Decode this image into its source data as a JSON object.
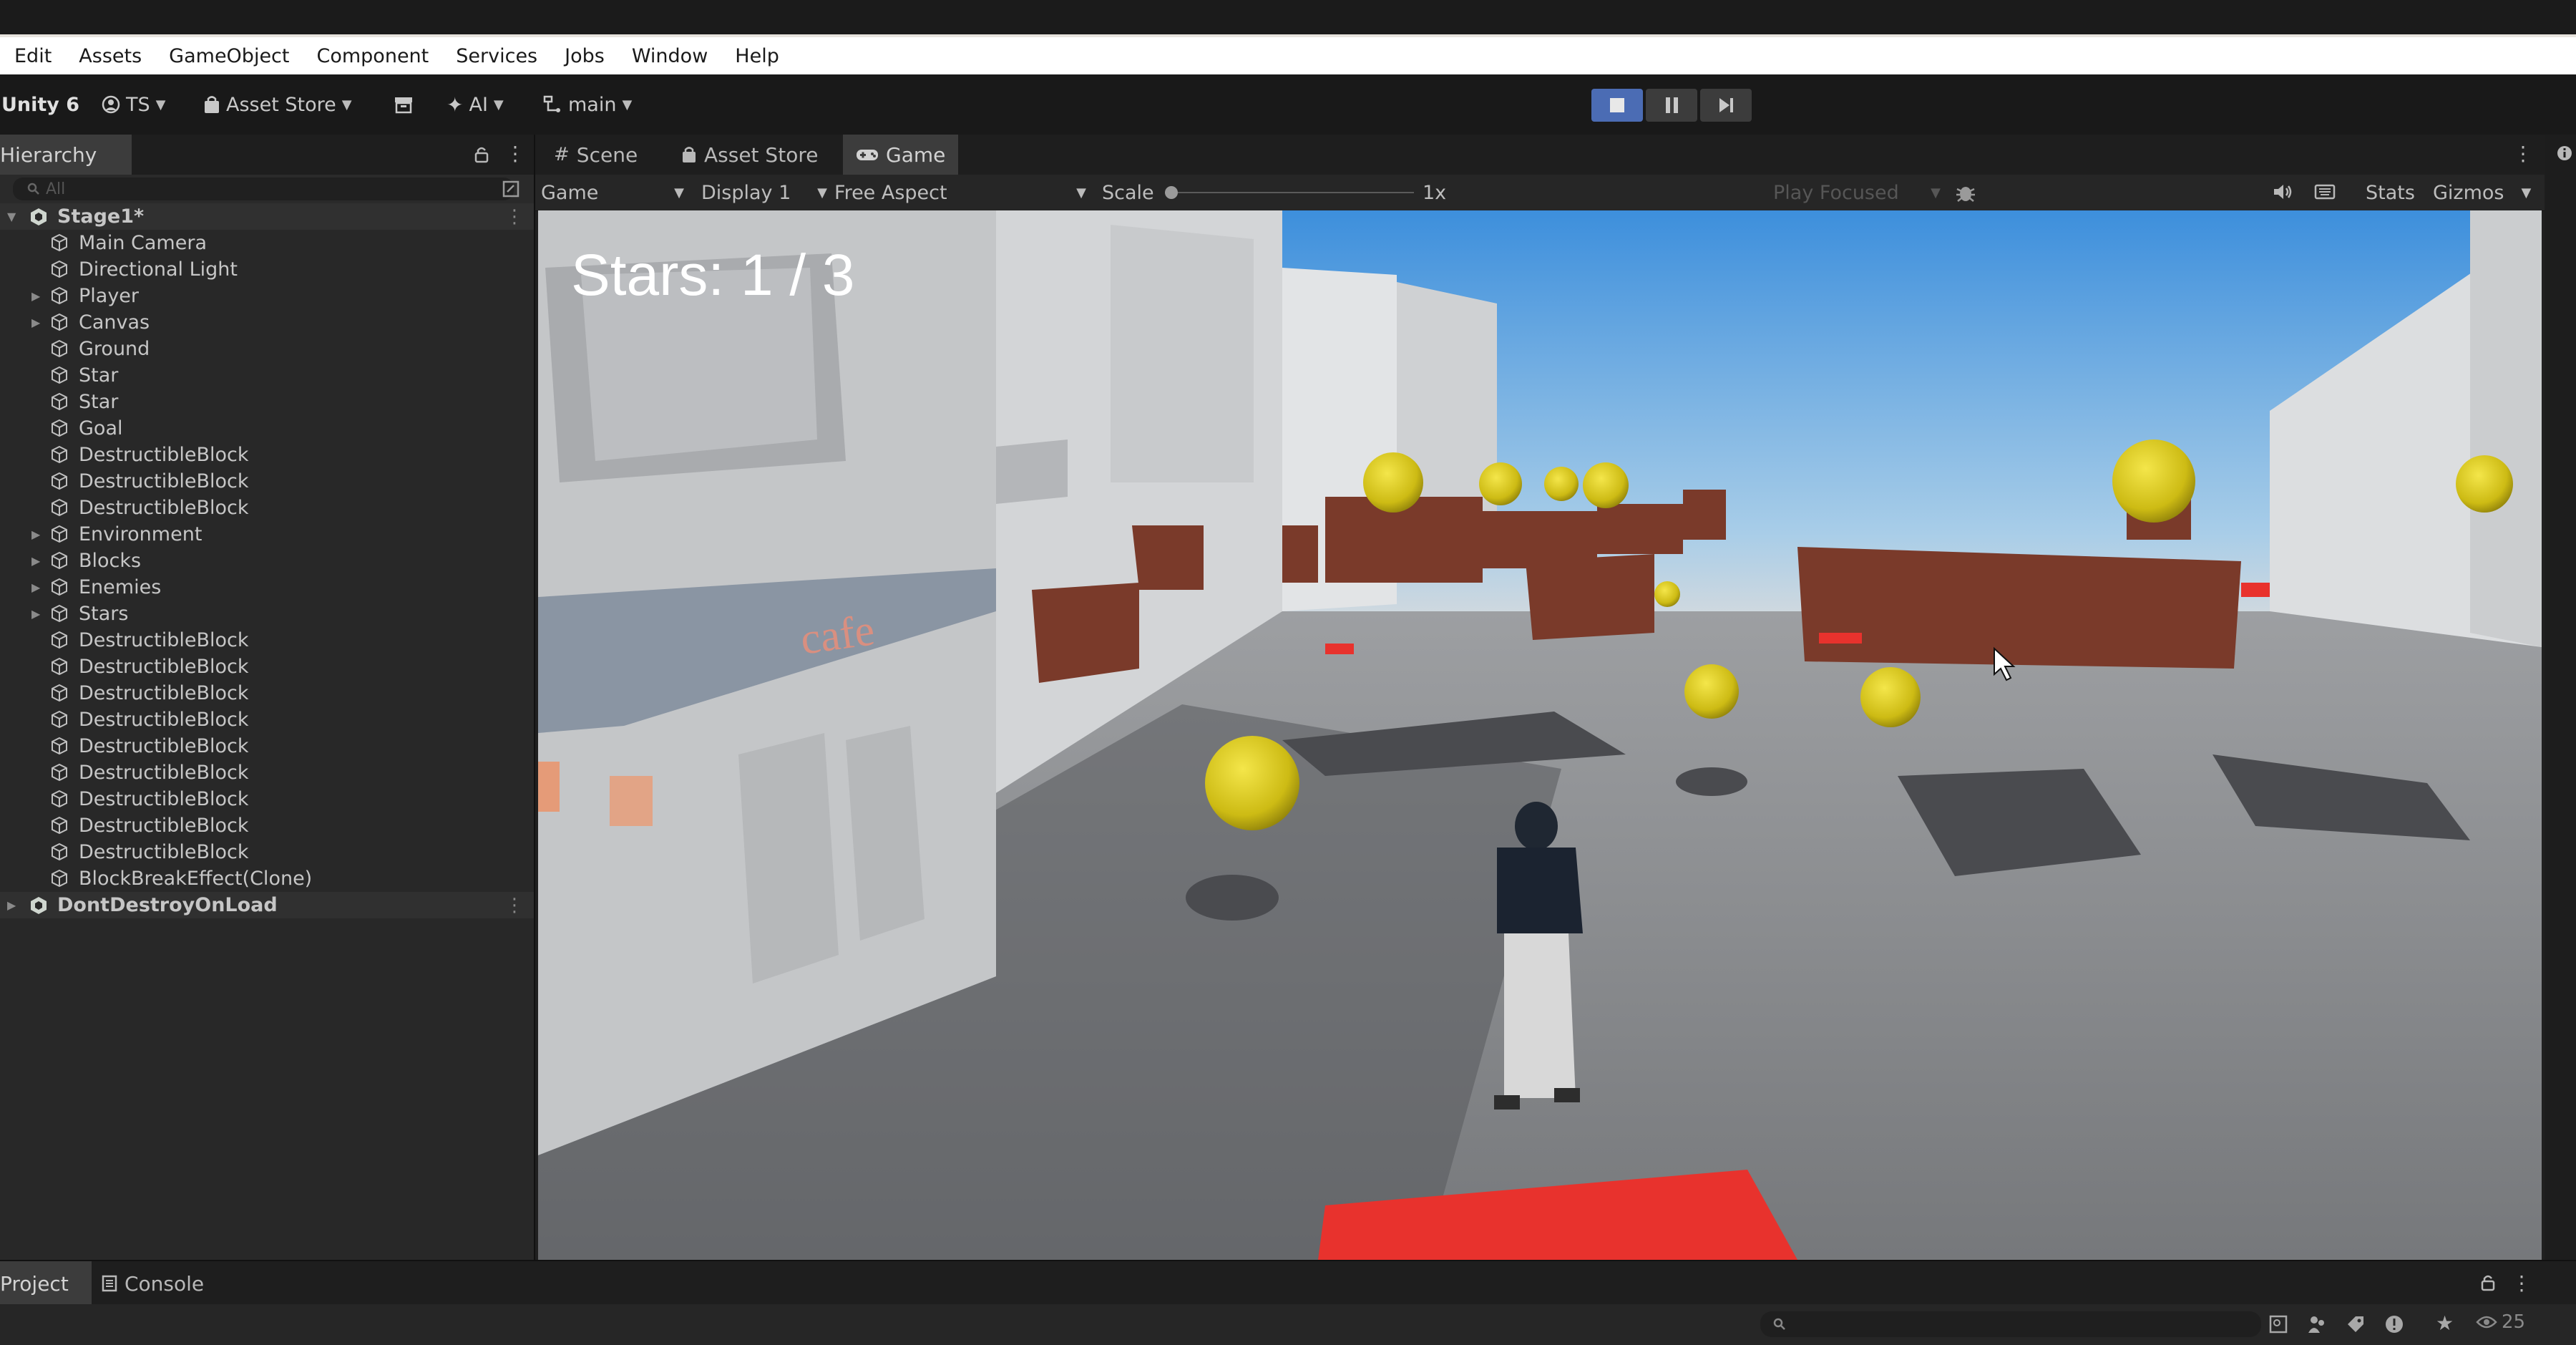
{
  "menu": [
    "Edit",
    "Assets",
    "GameObject",
    "Component",
    "Services",
    "Jobs",
    "Window",
    "Help"
  ],
  "toolbar": {
    "brand": "Unity 6",
    "account": "TS",
    "asset_store": "Asset Store",
    "ai": "AI",
    "branch": "main"
  },
  "hierarchy": {
    "tab_label": "Hierarchy",
    "search_placeholder": "All",
    "scene": "Stage1*",
    "items": [
      {
        "label": "Main Camera",
        "expandable": false
      },
      {
        "label": "Directional Light",
        "expandable": false
      },
      {
        "label": "Player",
        "expandable": true
      },
      {
        "label": "Canvas",
        "expandable": true
      },
      {
        "label": "Ground",
        "expandable": false
      },
      {
        "label": "Star",
        "expandable": false
      },
      {
        "label": "Star",
        "expandable": false
      },
      {
        "label": "Goal",
        "expandable": false
      },
      {
        "label": "DestructibleBlock",
        "expandable": false
      },
      {
        "label": "DestructibleBlock",
        "expandable": false
      },
      {
        "label": "DestructibleBlock",
        "expandable": false
      },
      {
        "label": "Environment",
        "expandable": true
      },
      {
        "label": "Blocks",
        "expandable": true
      },
      {
        "label": "Enemies",
        "expandable": true
      },
      {
        "label": "Stars",
        "expandable": true
      },
      {
        "label": "DestructibleBlock",
        "expandable": false
      },
      {
        "label": "DestructibleBlock",
        "expandable": false
      },
      {
        "label": "DestructibleBlock",
        "expandable": false
      },
      {
        "label": "DestructibleBlock",
        "expandable": false
      },
      {
        "label": "DestructibleBlock",
        "expandable": false
      },
      {
        "label": "DestructibleBlock",
        "expandable": false
      },
      {
        "label": "DestructibleBlock",
        "expandable": false
      },
      {
        "label": "DestructibleBlock",
        "expandable": false
      },
      {
        "label": "DestructibleBlock",
        "expandable": false
      },
      {
        "label": "BlockBreakEffect(Clone)",
        "expandable": false
      }
    ],
    "dont_destroy": "DontDestroyOnLoad"
  },
  "game_tabs": {
    "scene": "Scene",
    "asset_store": "Asset Store",
    "game": "Game"
  },
  "game_bar": {
    "mode": "Game",
    "display": "Display 1",
    "aspect": "Free Aspect",
    "scale_label": "Scale",
    "scale_value": "1x",
    "scale_level": 0.0,
    "play_focused": "Play Focused",
    "stats": "Stats",
    "gizmos": "Gizmos"
  },
  "hud": {
    "stars": "Stars: 1 / 3"
  },
  "bottom": {
    "project": "Project",
    "console": "Console",
    "count": "25"
  },
  "colors": {
    "accent": "#4b6cb4",
    "block": "#7a3a2a",
    "star": "#d7c51e",
    "goal": "#e8322d"
  }
}
